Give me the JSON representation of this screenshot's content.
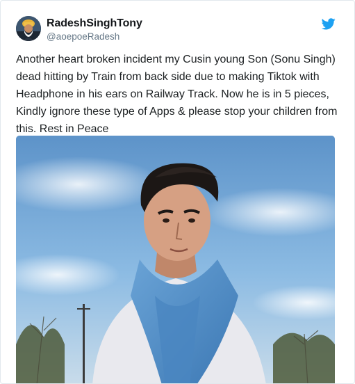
{
  "tweet": {
    "author": {
      "display_name": "RadeshSinghTony",
      "handle": "@aoepoeRadesh",
      "avatar_icon": "avatar-photo"
    },
    "platform_icon": "twitter-bird-icon",
    "text": "Another heart broken incident my Cusin young Son (Sonu Singh) dead hitting by Train from back side due to making Tiktok with Headphone in his ears on Railway Track. Now he is in 5 pieces, Kindly ignore these type of Apps & please stop your children from this. Rest in Peace",
    "media": {
      "type": "photo",
      "subject": "young man with blue scarf against sky"
    },
    "colors": {
      "twitter_blue": "#1da1f2",
      "name": "#14171a",
      "handle": "#657786",
      "text": "#1c2022",
      "border": "#e1e8ed"
    }
  }
}
